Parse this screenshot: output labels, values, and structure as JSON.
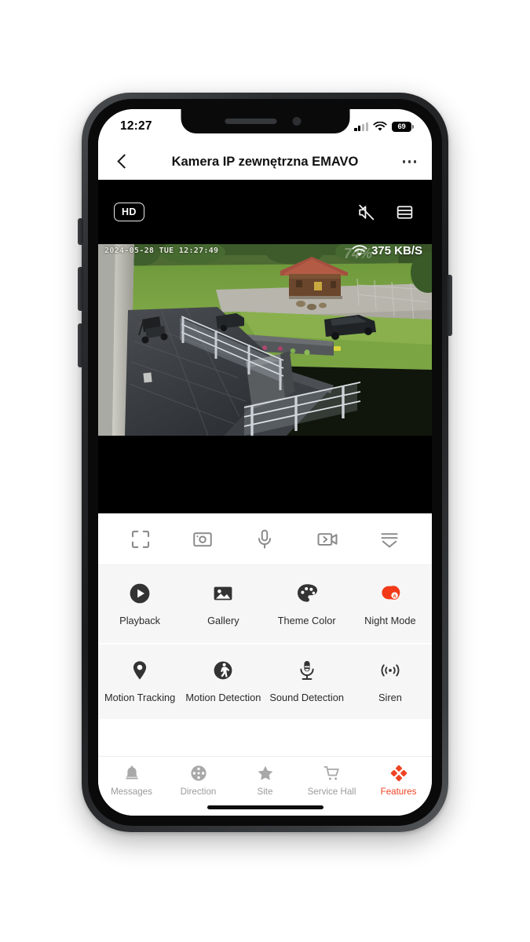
{
  "status_bar": {
    "time": "12:27",
    "battery_level": "69",
    "signal_icon": "cellular-signal-icon",
    "wifi_icon": "wifi-icon",
    "battery_icon": "battery-icon"
  },
  "header": {
    "title": "Kamera IP zewnętrzna EMAVO",
    "back_icon": "back-chevron-icon",
    "more_icon": "more-options-icon"
  },
  "player": {
    "quality_badge": "HD",
    "mute_icon": "speaker-muted-icon",
    "layout_icon": "split-view-icon",
    "osd_timestamp": "2024-05-28 TUE 12:27:49",
    "osd_bitrate": "375 KB/S",
    "osd_watermark": "74%",
    "osd_wifi_icon": "wifi-signal-icon"
  },
  "toolbar": {
    "items": [
      {
        "name": "fullscreen-button",
        "icon": "fullscreen-icon"
      },
      {
        "name": "snapshot-button",
        "icon": "camera-snapshot-icon"
      },
      {
        "name": "talk-button",
        "icon": "microphone-icon"
      },
      {
        "name": "record-button",
        "icon": "video-record-icon"
      },
      {
        "name": "expand-more-button",
        "icon": "expand-chevron-icon"
      }
    ]
  },
  "features": {
    "row1": [
      {
        "label": "Playback",
        "icon": "play-circle-icon",
        "color": "#333333"
      },
      {
        "label": "Gallery",
        "icon": "gallery-image-icon",
        "color": "#333333"
      },
      {
        "label": "Theme Color",
        "icon": "palette-icon",
        "color": "#333333"
      },
      {
        "label": "Night Mode",
        "icon": "night-mode-auto-icon",
        "color": "#f33a18"
      }
    ],
    "row2": [
      {
        "label": "Motion Tracking",
        "icon": "location-pin-icon",
        "color": "#333333"
      },
      {
        "label": "Motion Detection",
        "icon": "walking-person-icon",
        "color": "#333333"
      },
      {
        "label": "Sound Detection",
        "icon": "sound-microphone-icon",
        "color": "#333333"
      },
      {
        "label": "Siren",
        "icon": "siren-waves-icon",
        "color": "#333333"
      }
    ]
  },
  "tabbar": {
    "items": [
      {
        "label": "Messages",
        "icon": "bell-icon",
        "active": false
      },
      {
        "label": "Direction",
        "icon": "direction-pad-icon",
        "active": false
      },
      {
        "label": "Site",
        "icon": "star-icon",
        "active": false
      },
      {
        "label": "Service Hall",
        "icon": "shopping-cart-icon",
        "active": false
      },
      {
        "label": "Features",
        "icon": "features-diamonds-icon",
        "active": true
      }
    ]
  },
  "colors": {
    "accent": "#ef4323",
    "icon_dark": "#333333",
    "tab_inactive": "#9b9b9b",
    "feature_bg": "#f6f6f6"
  }
}
